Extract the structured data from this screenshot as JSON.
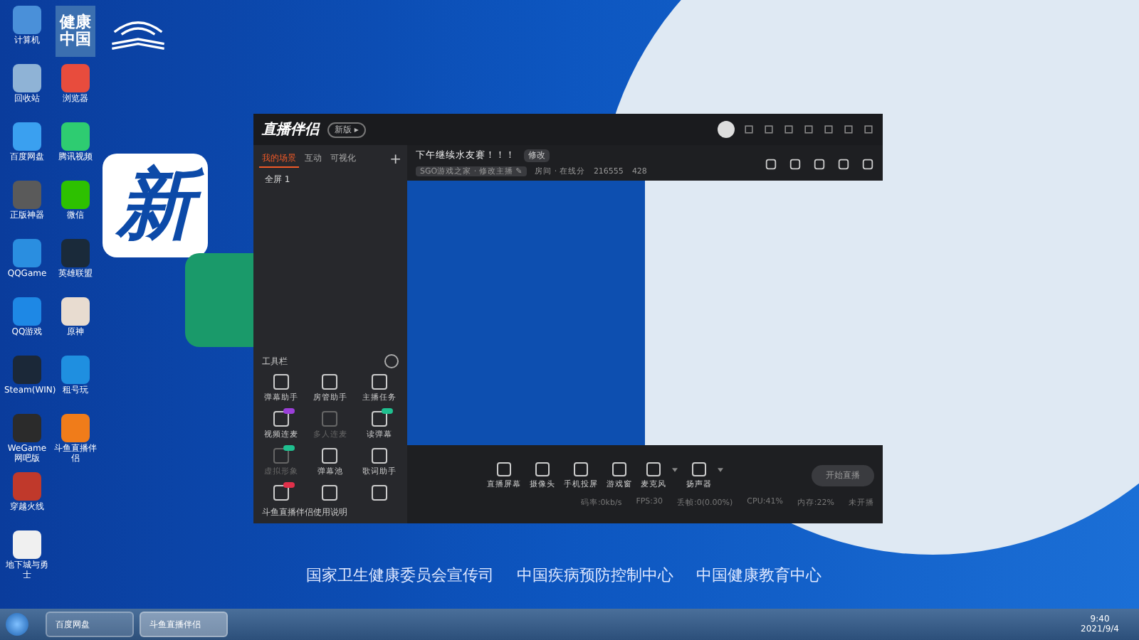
{
  "desktop": {
    "icons": [
      {
        "kind": "app",
        "label": "计算机",
        "color": "#4a90d9"
      },
      {
        "kind": "app",
        "label": "回收站",
        "color": "#8fb3d6"
      },
      {
        "kind": "app",
        "label": "百度网盘",
        "color": "#3aa0f0"
      },
      {
        "kind": "app",
        "label": "正版神器",
        "color": "#5a5a5a"
      },
      {
        "kind": "app",
        "label": "QQGame",
        "color": "#2a8ee0"
      },
      {
        "kind": "app",
        "label": "QQ游戏",
        "color": "#1e88e5"
      },
      {
        "kind": "app",
        "label": "Steam(WIN)",
        "color": "#1b2838"
      },
      {
        "kind": "app",
        "label": "WeGame网吧版",
        "color": "#2b2b2b"
      },
      {
        "kind": "app",
        "label": "穿越火线",
        "color": "#c0392b"
      },
      {
        "kind": "app",
        "label": "地下城与勇士",
        "color": "#f0f0f0"
      },
      {
        "kind": "tile",
        "label": "健康中国",
        "color": "#3b6fb0"
      },
      {
        "kind": "app",
        "label": "浏览器",
        "color": "#e84c3d"
      },
      {
        "kind": "app",
        "label": "腾讯视频",
        "color": "#2ecc71"
      },
      {
        "kind": "app",
        "label": "微信",
        "color": "#2dc100"
      },
      {
        "kind": "app",
        "label": "英雄联盟",
        "color": "#1a2a3a"
      },
      {
        "kind": "app",
        "label": "原神",
        "color": "#e8dcd0"
      },
      {
        "kind": "app",
        "label": "租号玩",
        "color": "#1f8fe0"
      },
      {
        "kind": "app",
        "label": "斗鱼直播伴侣",
        "color": "#f07c1a"
      }
    ],
    "headline": "新",
    "footer_orgs": [
      "国家卫生健康委员会宣传司",
      "中国疾病预防控制中心",
      "中国健康教育中心"
    ]
  },
  "app": {
    "logo": "直播伴侣",
    "version_badge": "新版 ▸",
    "tabs": [
      {
        "label": "我的场景",
        "selected": true
      },
      {
        "label": "互动",
        "selected": false
      },
      {
        "label": "可视化",
        "selected": false
      }
    ],
    "scenes": [
      {
        "label": "全屏 1"
      }
    ],
    "stream_title": "下午继续水友赛！！！",
    "edit_tag": "修改",
    "category": "SGO游戏之家 · 修改主播 ✎",
    "room": "房间 · 在线分",
    "room_id": "216555",
    "heat": "428",
    "tools_heading": "工具栏",
    "add_button": "+",
    "tools": [
      {
        "label": "弹幕助手",
        "disabled": false
      },
      {
        "label": "房管助手",
        "disabled": false
      },
      {
        "label": "主播任务",
        "disabled": false
      },
      {
        "label": "视频连麦",
        "disabled": false,
        "color": "#9b3fd9"
      },
      {
        "label": "多人连麦",
        "disabled": true
      },
      {
        "label": "读弹幕",
        "disabled": false,
        "color": "#1fbf8f"
      },
      {
        "label": "虚拟形象",
        "disabled": true,
        "color": "#1fbf8f"
      },
      {
        "label": "弹幕池",
        "disabled": false
      },
      {
        "label": "歌词助手",
        "disabled": false
      },
      {
        "disabled": false,
        "color": "#e0304a"
      },
      {
        "disabled": false
      },
      {
        "disabled": false
      }
    ],
    "notice": "斗鱼直播伴侣使用说明",
    "sources": [
      {
        "label": "直播屏幕",
        "dropdown": false
      },
      {
        "label": "摄像头",
        "dropdown": false
      },
      {
        "label": "手机投屏",
        "dropdown": false
      },
      {
        "label": "游戏窗",
        "dropdown": false
      },
      {
        "label": "麦克风",
        "dropdown": true
      },
      {
        "label": "扬声器",
        "dropdown": true
      }
    ],
    "start_button": "开始直播",
    "status": [
      "码率:0kb/s",
      "FPS:30",
      "丢帧:0(0.00%)",
      "CPU:41%",
      "内存:22%",
      "未开播"
    ]
  },
  "taskbar": {
    "buttons": [
      {
        "label": "百度网盘",
        "selected": false
      },
      {
        "label": "斗鱼直播伴侣",
        "selected": true
      }
    ],
    "time": "9:40",
    "date": "2021/9/4"
  }
}
